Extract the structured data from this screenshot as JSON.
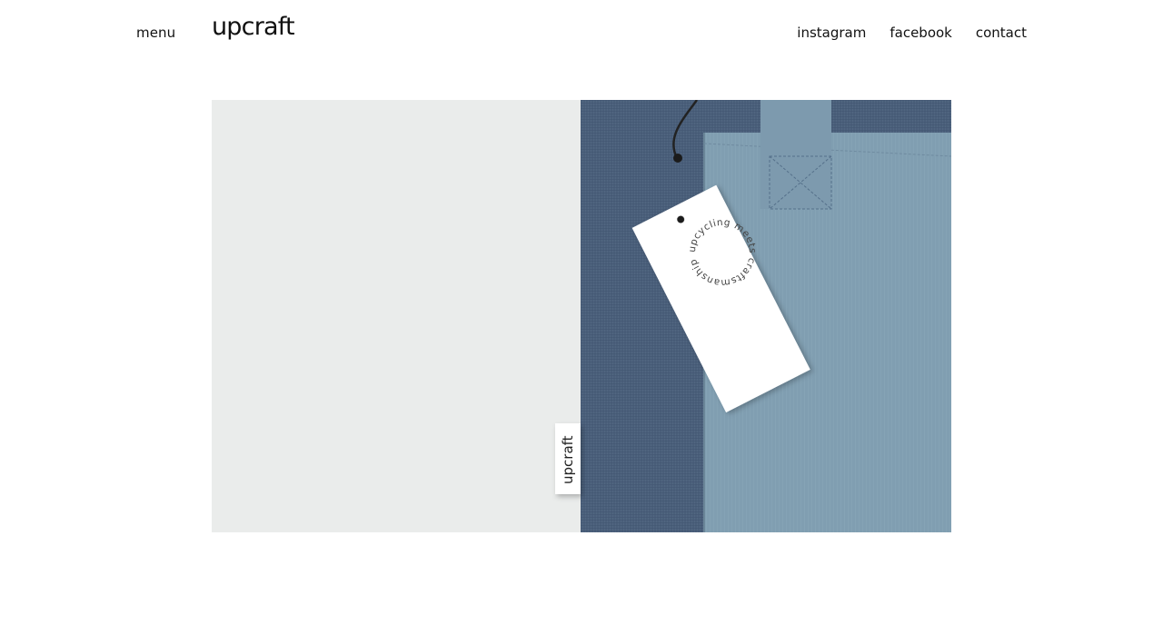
{
  "header": {
    "menu_label": "menu",
    "logo_text": "upcraft",
    "nav": [
      "instagram",
      "facebook",
      "contact"
    ]
  },
  "hero": {
    "hang_tag_text": "upcycling meets craftsmanship",
    "side_label_text": "upcraft"
  },
  "colors": {
    "background": "#ffffff",
    "hero_left": "#eaeceb",
    "dark_fabric": "#4a5f7a",
    "light_fabric": "#7f9db0"
  }
}
